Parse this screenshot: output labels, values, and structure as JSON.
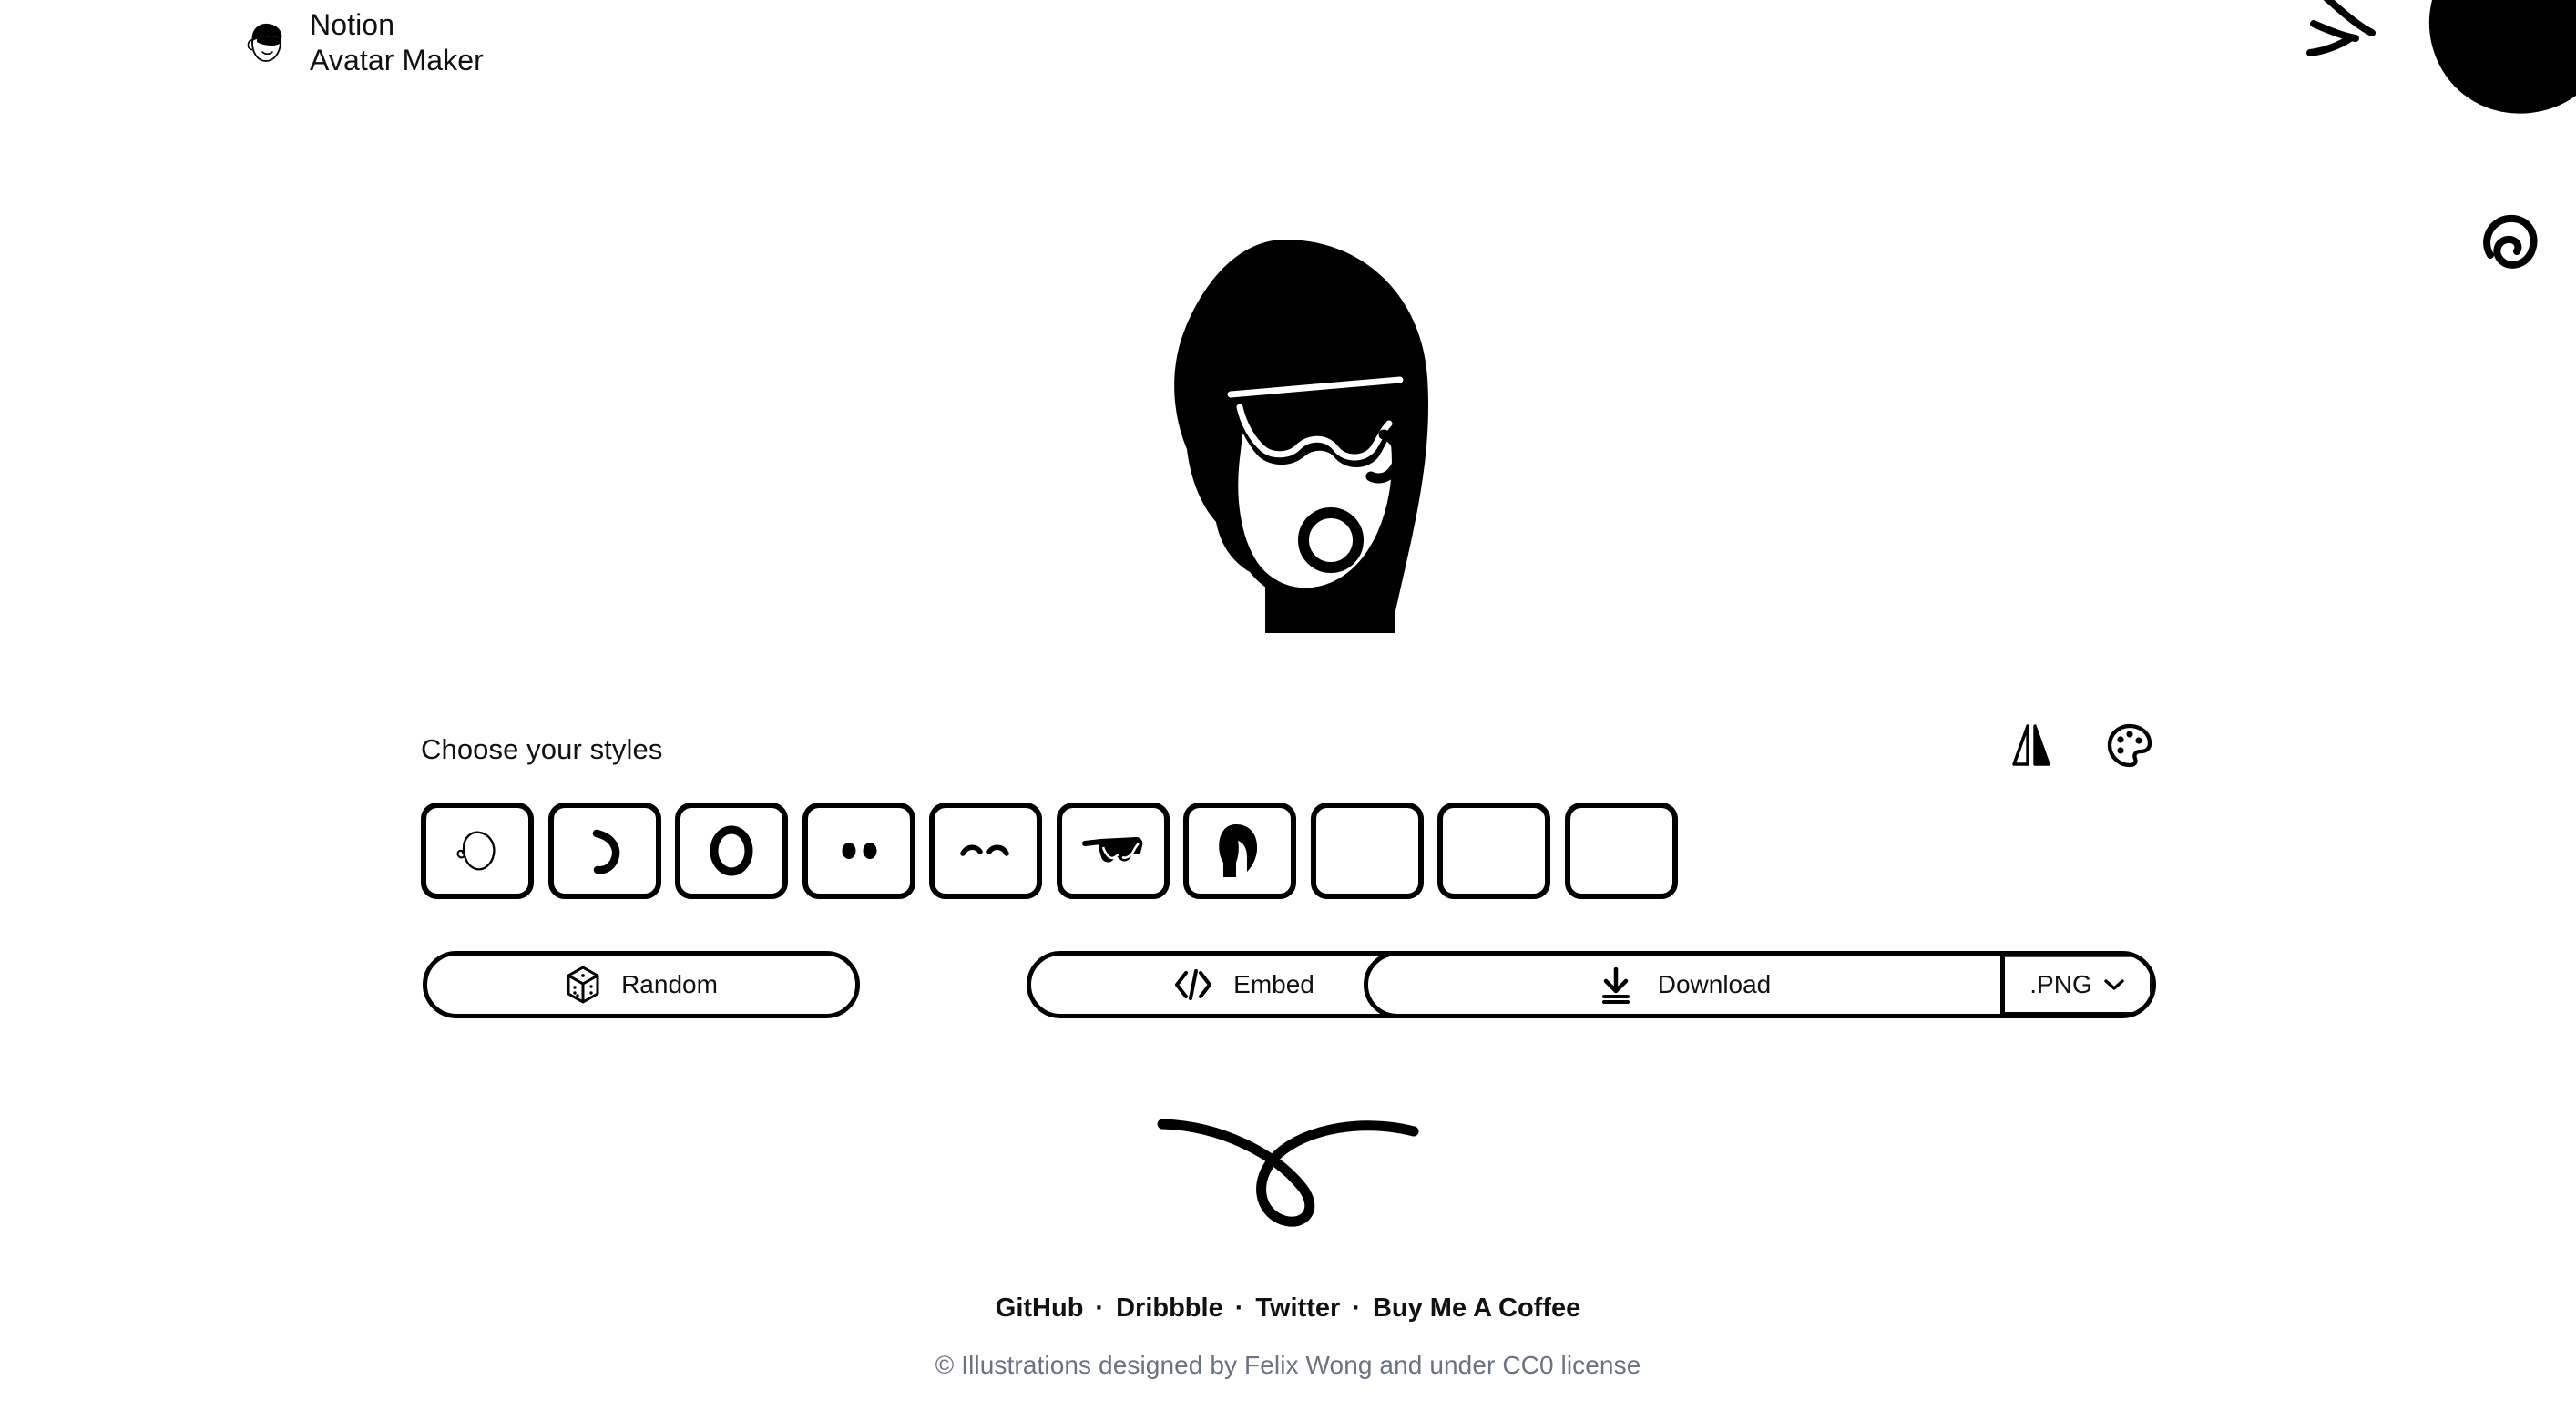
{
  "brand": {
    "logo_icon": "avatar-face-logo-icon",
    "line1": "Notion",
    "line2": "Avatar Maker"
  },
  "preview": {
    "avatar_description": "long-black-hair-goggles-open-mouth-avatar"
  },
  "editor": {
    "section_title": "Choose your styles",
    "tools": [
      {
        "name": "flip-horizontal-icon",
        "label": "Flip"
      },
      {
        "name": "palette-icon",
        "label": "Colors"
      }
    ],
    "style_cells": [
      {
        "name": "style-face-shape",
        "icon": "face-shape-icon"
      },
      {
        "name": "style-ear",
        "icon": "ear-icon"
      },
      {
        "name": "style-mouth",
        "icon": "mouth-ring-icon"
      },
      {
        "name": "style-eyes",
        "icon": "eyes-dots-icon"
      },
      {
        "name": "style-eyebrows",
        "icon": "eyebrows-arcs-icon"
      },
      {
        "name": "style-glasses",
        "icon": "glasses-goggles-icon"
      },
      {
        "name": "style-hair",
        "icon": "long-hair-icon"
      },
      {
        "name": "style-empty-1",
        "icon": "empty-icon"
      },
      {
        "name": "style-empty-2",
        "icon": "empty-icon"
      },
      {
        "name": "style-empty-3",
        "icon": "empty-icon"
      }
    ]
  },
  "actions": {
    "random_label": "Random",
    "random_icon": "dice-icon",
    "embed_label": "Embed",
    "embed_icon": "code-brackets-icon",
    "download_label": "Download",
    "download_icon": "download-icon",
    "format_value": ".PNG",
    "format_caret_icon": "chevron-down-icon"
  },
  "footer": {
    "links": [
      {
        "label": "GitHub"
      },
      {
        "label": "Dribbble"
      },
      {
        "label": "Twitter"
      },
      {
        "label": "Buy Me A Coffee"
      }
    ],
    "separator": "·",
    "copyright": "© Illustrations designed by Felix Wong and under CC0 license"
  },
  "decorations": [
    {
      "name": "doodle-strokes-icon"
    },
    {
      "name": "doodle-blob-icon"
    },
    {
      "name": "doodle-spiral-icon"
    },
    {
      "name": "doodle-loop-icon"
    }
  ],
  "colors": {
    "ink": "#000000",
    "text": "#111111",
    "muted": "#6b7280",
    "background": "#ffffff"
  }
}
